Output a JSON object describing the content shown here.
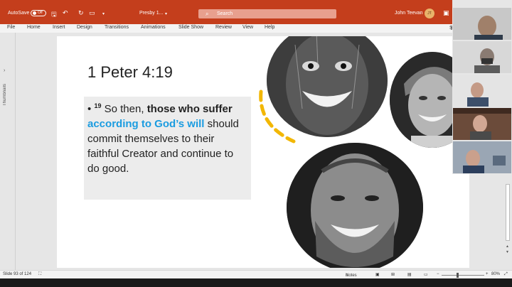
{
  "titlebar": {
    "autosave_label": "AutoSave",
    "autosave_state": "Off",
    "doc_title": "Presby 1...",
    "search_placeholder": "Search",
    "user_name": "John Teevan",
    "user_initials": "JT"
  },
  "ribbon": {
    "tabs": [
      "File",
      "Home",
      "Insert",
      "Design",
      "Transitions",
      "Animations",
      "Slide Show",
      "Review",
      "View",
      "Help"
    ],
    "share_label": "Sh"
  },
  "left_panel": {
    "label": "Thumbnails"
  },
  "slide": {
    "title": "1 Peter 4:19",
    "bullet": "•",
    "verse_number": "19",
    "text_1": "So then,",
    "text_bold": "those who suffer",
    "text_accent": "according to God’s will",
    "text_2": "should commit themselves to their faithful Creator and continue to do good."
  },
  "statusbar": {
    "slide_info": "Slide 93 of 124",
    "notes_label": "Notes",
    "zoom": "80%"
  },
  "colors": {
    "powerpoint_brand": "#c43e1c",
    "accent_text": "#1b9ce0",
    "curve": "#f2b705"
  }
}
